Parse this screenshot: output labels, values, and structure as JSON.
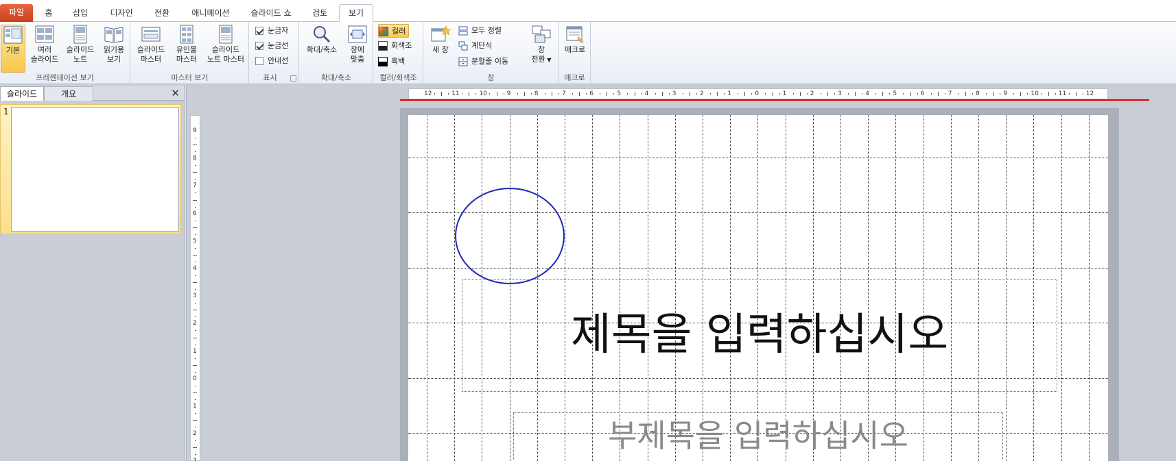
{
  "tabs": [
    {
      "label": "파일"
    },
    {
      "label": "홈"
    },
    {
      "label": "삽입"
    },
    {
      "label": "디자인"
    },
    {
      "label": "전환"
    },
    {
      "label": "애니메이션"
    },
    {
      "label": "슬라이드 쇼"
    },
    {
      "label": "검토"
    },
    {
      "label": "보기"
    }
  ],
  "ribbon": {
    "presentation_views": {
      "label": "프레젠테이션 보기",
      "normal": "기본",
      "slide_sorter_1": "여러",
      "slide_sorter_2": "슬라이드",
      "notes_1": "슬라이드",
      "notes_2": "노트",
      "reading_1": "읽기용",
      "reading_2": "보기"
    },
    "master_views": {
      "label": "마스터 보기",
      "slide_master_1": "슬라이드",
      "slide_master_2": "마스터",
      "handout_master_1": "유인물",
      "handout_master_2": "마스터",
      "notes_master_1": "슬라이드",
      "notes_master_2": "노트 마스터"
    },
    "show": {
      "label": "표시",
      "ruler": "눈금자",
      "gridlines": "눈금선",
      "guides": "안내선",
      "ruler_checked": true,
      "gridlines_checked": true,
      "guides_checked": false
    },
    "zoom": {
      "label": "확대/축소",
      "zoom_btn": "확대/축소",
      "fit_1": "창에",
      "fit_2": "맞춤"
    },
    "color": {
      "label": "컬러/회색조",
      "color": "컬러",
      "grayscale": "회색조",
      "bw": "흑백"
    },
    "window": {
      "label": "창",
      "new_window": "새 창",
      "arrange_all": "모두 정렬",
      "cascade": "계단식",
      "move_split": "분할줄 이동",
      "switch_1": "창",
      "switch_2": "전환"
    },
    "macros": {
      "label": "매크로",
      "macros_btn": "매크로"
    }
  },
  "left_pane": {
    "tab_slides": "슬라이드",
    "tab_outline": "개요",
    "close": "✕",
    "slide_number": "1"
  },
  "ruler": {
    "h_labels": [
      "12",
      "11",
      "10",
      "9",
      "8",
      "7",
      "6",
      "5",
      "4",
      "3",
      "2",
      "1",
      "0",
      "1",
      "2",
      "3",
      "4",
      "5",
      "6",
      "7",
      "8",
      "9",
      "10",
      "11",
      "12"
    ],
    "v_labels": [
      "9",
      "8",
      "7",
      "6",
      "5",
      "4",
      "3",
      "2",
      "1",
      "0",
      "1",
      "2",
      "3"
    ]
  },
  "slide": {
    "title_placeholder": "제목을 입력하십시오",
    "subtitle_placeholder": "부제목을 입력하십시오",
    "ellipse_color": "#1f27b8"
  },
  "colors": {
    "file_tab": "#d24726",
    "accent_highlight": "#f7c74b",
    "ruler_marker": "#e00000"
  }
}
